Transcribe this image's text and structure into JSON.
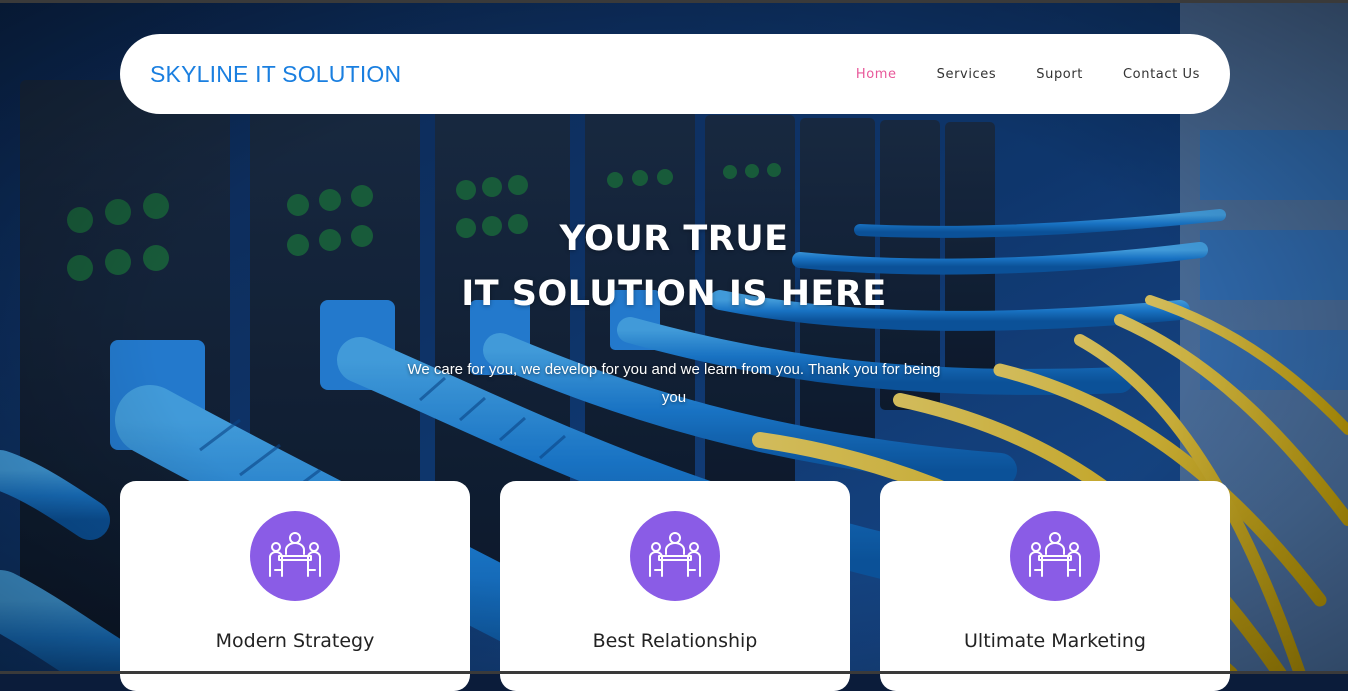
{
  "brand": "SKYLINE IT SOLUTION",
  "nav": {
    "items": [
      "Home",
      "Services",
      "Suport",
      "Contact Us"
    ],
    "active": "Home"
  },
  "hero": {
    "title_line1": "YOUR TRUE",
    "title_line2": "IT SOLUTION IS HERE",
    "subtitle": "We care for you, we develop for you and we learn from you. Thank you for being you"
  },
  "features": [
    {
      "title": "Modern Strategy",
      "icon": "team-meeting-icon"
    },
    {
      "title": "Best Relationship",
      "icon": "team-meeting-icon"
    },
    {
      "title": "Ultimate Marketing",
      "icon": "team-meeting-icon"
    }
  ],
  "colors": {
    "brand": "#1a7fe0",
    "nav_active": "#e8589a",
    "icon_bg": "#8a5ce6"
  }
}
